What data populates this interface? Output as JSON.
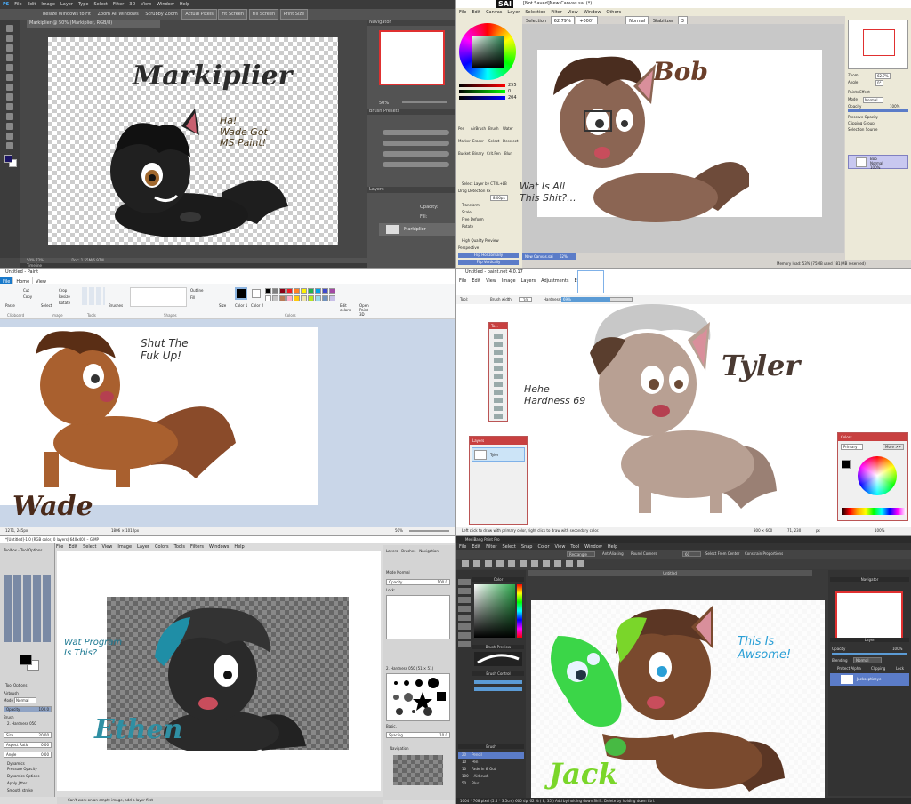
{
  "photoshop": {
    "menu": [
      "PS",
      "File",
      "Edit",
      "Image",
      "Layer",
      "Type",
      "Select",
      "Filter",
      "3D",
      "View",
      "Window",
      "Help"
    ],
    "options": [
      "Resize Windows to Fit",
      "Zoom All Windows",
      "Scrubby Zoom",
      "Actual Pixels",
      "Fit Screen",
      "Fill Screen",
      "Print Size"
    ],
    "doc_tab": "Markiplier @ 50% (Markiplier, RGB/8)",
    "panels": {
      "navigator": "Navigator",
      "brush_presets": "Brush Presets",
      "layers": "Layers",
      "opacity": "Opacity:",
      "fill": "Fill:"
    },
    "zoom_value": "50%",
    "layer": "Markiplier",
    "status": "Doc: 1.55M/6.97M",
    "timeline": "Timeline",
    "zoom_left": "50% 72%",
    "title": "Markiplier",
    "bubble": "Ha!\nWade Got\nMS Paint!",
    "colors": {
      "fg": "#1b1464",
      "bg": "#ffffff"
    }
  },
  "sai": {
    "logo": "SAI",
    "window_title": "[Not Saved]New Canvas.sai (*)",
    "menu": [
      "File",
      "Edit",
      "Canvas",
      "Layer",
      "Selection",
      "Filter",
      "View",
      "Window",
      "Others"
    ],
    "toolbar": {
      "selection": "Selection",
      "zoom": "62.79%",
      "angle": "+000°",
      "mode": "Normal",
      "stabilizer_label": "Stabilizer",
      "stabilizer": "3"
    },
    "tools": [
      "Pen",
      "AirBrush",
      "Brush",
      "Water",
      "Marker",
      "Eraser",
      "Select",
      "Deselect",
      "Bucket",
      "Binary",
      "Crit.Pen",
      "Blur"
    ],
    "options": [
      "Select Layer by CTRL+LB",
      "Drag Detection Px",
      "Transform",
      "Scale",
      "Free Deform",
      "Rotate",
      "High Quality Preview"
    ],
    "perspective": "Perspective",
    "px_value": "8.00px",
    "buttons": [
      "Flip Horizontally",
      "Flip Vertically",
      "Rotate 90° CCW",
      "Rotate 90° CW"
    ],
    "rgb": [
      "R",
      "G",
      "B"
    ],
    "rgb_values": [
      "255",
      "0",
      "204"
    ],
    "right": {
      "zoom": "Zoom",
      "zoom_val": "62.7%",
      "angle": "Angle",
      "angle_val": "0°",
      "paints_effect": "Paints Effect",
      "mode": "Mode",
      "mode_val": "Normal",
      "opacity": "Opacity",
      "opacity_val": "100%",
      "preserve": "Preserve Opacity",
      "clipping": "Clipping Group",
      "selsource": "Selection Source",
      "layer_name": "Bob",
      "layer_mode": "Normal",
      "layer_op": "100%"
    },
    "doc_tab": "New Canvas.sai",
    "doc_zoom": "62%",
    "status": "Memory load: 53% (75MB used / 81(MB reserved)",
    "title": "Bob",
    "bubble": "Wat Is All\nThis Shit?..."
  },
  "mspaint": {
    "title": "Untitled - Paint",
    "tabs": [
      "File",
      "Home",
      "View"
    ],
    "groups": [
      "Clipboard",
      "Image",
      "Tools",
      "Shapes",
      "Colors"
    ],
    "clipboard": [
      "Paste",
      "Cut",
      "Copy"
    ],
    "image": [
      "Select",
      "Crop",
      "Resize",
      "Rotate"
    ],
    "shape_opts": [
      "Outline",
      "Fill"
    ],
    "tool_labels": [
      "Brushes",
      "Size",
      "Color 1",
      "Color 2",
      "Edit colors",
      "Open Paint 3D"
    ],
    "palette": [
      "#000000",
      "#7f7f7f",
      "#880015",
      "#ed1c24",
      "#ff7f27",
      "#fff200",
      "#22b14c",
      "#00a2e8",
      "#3f48cc",
      "#a349a4",
      "#ffffff",
      "#c3c3c3",
      "#b97a57",
      "#ffaec9",
      "#ffc90e",
      "#efe4b0",
      "#b5e61d",
      "#99d9ea",
      "#7092be",
      "#c8bfe7"
    ],
    "status_pos": "1271, 245px",
    "status_size": "1806 × 1012px",
    "zoom": "50%",
    "title_art": "Wade",
    "bubble": "Shut The\nFuk Up!"
  },
  "pdn": {
    "title": "Untitled - paint.net 4.0.17",
    "menu": [
      "File",
      "Edit",
      "View",
      "Image",
      "Layers",
      "Adjustments",
      "Effects"
    ],
    "toolbar": {
      "tool": "Tool:",
      "brush_width": "Brush width:",
      "brush_val": "20",
      "hardness": "Hardness:",
      "hardness_val": "69%"
    },
    "tools_title": "To...",
    "layers_title": "Layers",
    "layer": "Tyler",
    "colors_title": "Colors",
    "primary": "Primary",
    "more": "More >>",
    "status": "Left click to draw with primary color, right click to draw with secondary color.",
    "size": "800 × 600",
    "pos": "71, 230",
    "unit": "px",
    "zoom": "100%",
    "title_art": "Tyler",
    "bubble": "Hehe\nHardness 69"
  },
  "gimp": {
    "title": "*[Untitled]-1.0 (RGB color, 0 layers) 640x400 – GIMP",
    "menu": [
      "File",
      "Edit",
      "Select",
      "View",
      "Image",
      "Layer",
      "Colors",
      "Tools",
      "Filters",
      "Windows",
      "Help"
    ],
    "toolbox": "Toolbox - Tool Options",
    "tool_options": "Tool Options",
    "airbrush": "Airbrush",
    "mode": "Mode",
    "mode_val": "Normal",
    "opacity": "Opacity",
    "opacity_val": "100.0",
    "brush": "Brush",
    "brush_val": "2. Hardness 050",
    "size": "Size",
    "size_val": "20.00",
    "aspect": "Aspect Ratio",
    "aspect_val": "0.00",
    "angle": "Angle",
    "angle_val": "0.00",
    "dynamics": "Dynamics",
    "dynamics_val": "Pressure Opacity",
    "dyn_opts": "Dynamics Options",
    "apply_jitter": "Apply Jitter",
    "smooth": "Smooth stroke",
    "right_title": "Layers - Brushes - Navigation",
    "right_mode": "Mode Normal",
    "right_opacity": "Opacity",
    "right_op_val": "100.0",
    "right_lock": "Lock:",
    "brushes_label": "2. Hardness 050 (51 × 51)",
    "basic": "Basic,",
    "spacing": "Spacing",
    "spacing_val": "10.0",
    "nav": "Navigation",
    "status": "Can't work on an empty image, add a layer first",
    "title_art": "Ethen",
    "bubble": "Wat Program\nIs This?"
  },
  "medibang": {
    "title": "MediBang Paint Pro",
    "menu": [
      "File",
      "Edit",
      "Filter",
      "Select",
      "Snap",
      "Color",
      "View",
      "Tool",
      "Window",
      "Help"
    ],
    "toolbar": {
      "shape": "Rectangle",
      "antialias": "AntiAliasing",
      "round": "Round Corners",
      "round_val": "60",
      "center": "Select From Center",
      "constrain": "Constrain Proportions"
    },
    "doc_tab": "Untitled",
    "color": "Color",
    "brush_preview": "Brush Preview",
    "brush_control": "Brush Control",
    "brush_panel": "Brush",
    "brushes": [
      {
        "size": "20",
        "name": "Pencil"
      },
      {
        "size": "10",
        "name": "Pen"
      },
      {
        "size": "10",
        "name": "Fade In & Out"
      },
      {
        "size": "100",
        "name": "Airbrush"
      },
      {
        "size": "50",
        "name": "Blur"
      }
    ],
    "navigator": "Navigator",
    "layer_panel": "Layer",
    "opacity": "Opacity",
    "opacity_val": "100%",
    "blending": "Blending",
    "blending_val": "Normal",
    "protect_alpha": "Protect Alpha",
    "clipping": "Clipping",
    "lock": "Lock",
    "layer": "Jacksepticeye",
    "status": "1004 * 768 pixel  (5.5 * 3.5cm)  600 dpi  62 %  ( 8, 35 )  Add by holding down Shift. Delete by holding down Ctrl.",
    "title_art": "Jack",
    "bubble": "This Is\nAwsome!"
  }
}
